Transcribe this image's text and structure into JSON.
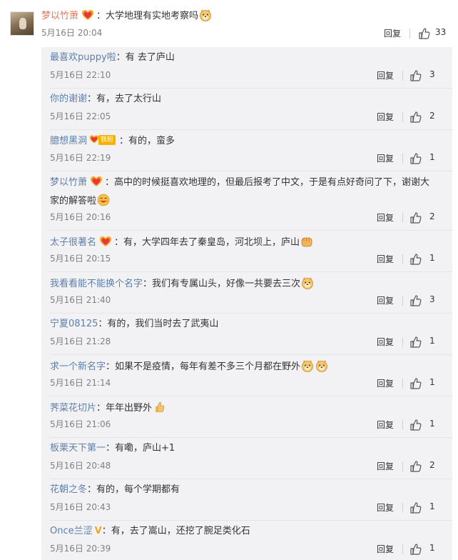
{
  "main_comment": {
    "username": "梦以竹萧",
    "separator": "：",
    "text": "大学地理有实地考察吗",
    "date": "5月16日 20:04",
    "reply_label": "回复",
    "likes": "33"
  },
  "replies": [
    {
      "username": "最喜欢puppy啦",
      "separator": "：",
      "text": "有 去了庐山",
      "date": "5月16日 22:10",
      "reply_label": "回复",
      "likes": "3"
    },
    {
      "username": "你的谢谢",
      "separator": "：",
      "text": "有，去了太行山",
      "date": "5月16日 22:05",
      "reply_label": "回复",
      "likes": "2"
    },
    {
      "username": "臆想黑洞",
      "fan_badge": "铁粉",
      "separator": "：",
      "text": "有的，蛮多",
      "date": "5月16日 22:19",
      "reply_label": "回复",
      "likes": "1"
    },
    {
      "username": "梦以竹萧",
      "separator": "：",
      "text": "高中的时候挺喜欢地理的，但最后报考了中文，于是有点好奇问了下，谢谢大",
      "text2": "家的解答啦",
      "date": "5月16日 20:16",
      "reply_label": "回复",
      "likes": "2"
    },
    {
      "username": "太子很著名",
      "separator": "：",
      "text": "有，大学四年去了秦皇岛，河北坝上，庐山",
      "date": "5月16日 20:15",
      "reply_label": "回复",
      "likes": "1"
    },
    {
      "username": "我看看能不能换个名字",
      "separator": "：",
      "text": "我们有专属山头，好像一共要去三次",
      "date": "5月16日 21:40",
      "reply_label": "回复",
      "likes": "3"
    },
    {
      "username": "宁夏08125",
      "separator": "：",
      "text": "有的，我们当时去了武夷山",
      "date": "5月16日 21:28",
      "reply_label": "回复",
      "likes": "1"
    },
    {
      "username": "求一个新名字",
      "separator": "：",
      "text": "如果不是疫情，每年有差不多三个月都在野外",
      "date": "5月16日 21:14",
      "reply_label": "回复",
      "likes": "1"
    },
    {
      "username": "荠菜花切片",
      "separator": "：",
      "text": "年年出野外",
      "date": "5月16日 21:06",
      "reply_label": "回复",
      "likes": "1"
    },
    {
      "username": "板栗天下第一",
      "separator": "：",
      "text": "有嘞，庐山+1",
      "date": "5月16日 20:48",
      "reply_label": "回复",
      "likes": "2"
    },
    {
      "username": "花朝之冬",
      "separator": "：",
      "text": "有的，每个学期都有",
      "date": "5月16日 20:43",
      "reply_label": "回复",
      "likes": "1"
    },
    {
      "username": "Once兰涩",
      "separator": "：",
      "text": "有，去了嵩山，还挖了腕足类化石",
      "date": "5月16日 20:39",
      "reply_label": "回复",
      "likes": "1"
    }
  ],
  "colors": {
    "username": "#eb7350",
    "reply_username": "#5d7fa8",
    "reply_bg": "#f2f2f5",
    "meta": "#808080"
  },
  "icons": {
    "like": "thumbs-up-icon",
    "doge": "doge-emoji",
    "heart_badge": "heart-badge-icon",
    "vip": "vip-v-icon",
    "fist": "fist-emoji",
    "thumb": "thumbs-up-emoji",
    "laugh": "laugh-emoji"
  }
}
